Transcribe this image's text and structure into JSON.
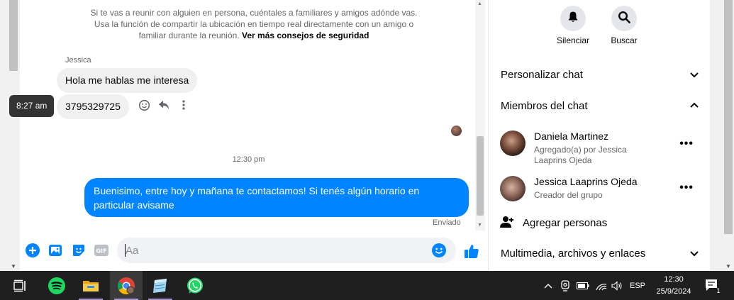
{
  "chat": {
    "safety_text": "Si te vas a reunir con alguien en persona, cuéntales a familiares y amigos adónde vas. Usa la función de compartir la ubicación en tiempo real directamente con un amigo o familiar durante la reunión.",
    "safety_link": "Ver más consejos de seguridad",
    "sender_name": "Jessica",
    "messages_in": [
      "Hola me hablas me interesa",
      "3795329725"
    ],
    "hover_time": "8:27 am",
    "timestamp": "12:30 pm",
    "message_out": "Buenisimo, entre hoy y mañana te contactamos! Si tenés algún horario en particular avisame",
    "status": "Enviado",
    "input_placeholder": "Aa"
  },
  "panel": {
    "mute_label": "Silenciar",
    "search_label": "Buscar",
    "customize_label": "Personalizar chat",
    "members_label": "Miembros del chat",
    "members": [
      {
        "name": "Daniela Martinez",
        "sub": "Agregado(a) por Jessica Laaprins Ojeda"
      },
      {
        "name": "Jessica Laaprins Ojeda",
        "sub": "Creador del grupo"
      }
    ],
    "add_people_label": "Agregar personas",
    "media_label": "Multimedia, archivos y enlaces"
  },
  "taskbar": {
    "language": "ESP",
    "time": "12:30",
    "date": "25/9/2024",
    "notification_count": "1"
  },
  "colors": {
    "accent": "#0084ff",
    "incoming_bubble": "#f0f0f0",
    "taskbar": "#1f1f1f"
  }
}
